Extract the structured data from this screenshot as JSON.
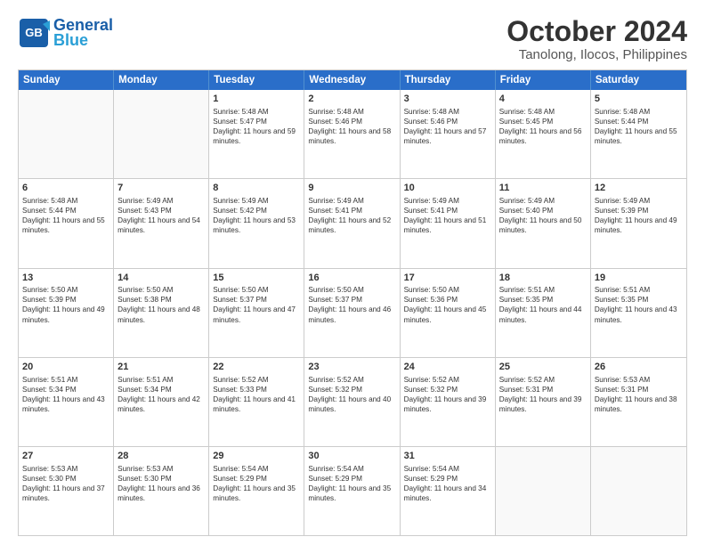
{
  "header": {
    "logo_line1": "General",
    "logo_line2": "Blue",
    "month": "October 2024",
    "location": "Tanolong, Ilocos, Philippines"
  },
  "days": [
    "Sunday",
    "Monday",
    "Tuesday",
    "Wednesday",
    "Thursday",
    "Friday",
    "Saturday"
  ],
  "weeks": [
    [
      {
        "day": "",
        "empty": true
      },
      {
        "day": "",
        "empty": true
      },
      {
        "day": "1",
        "sr": "5:48 AM",
        "ss": "5:47 PM",
        "dl": "11 hours and 59 minutes."
      },
      {
        "day": "2",
        "sr": "5:48 AM",
        "ss": "5:46 PM",
        "dl": "11 hours and 58 minutes."
      },
      {
        "day": "3",
        "sr": "5:48 AM",
        "ss": "5:46 PM",
        "dl": "11 hours and 57 minutes."
      },
      {
        "day": "4",
        "sr": "5:48 AM",
        "ss": "5:45 PM",
        "dl": "11 hours and 56 minutes."
      },
      {
        "day": "5",
        "sr": "5:48 AM",
        "ss": "5:44 PM",
        "dl": "11 hours and 55 minutes."
      }
    ],
    [
      {
        "day": "6",
        "sr": "5:48 AM",
        "ss": "5:44 PM",
        "dl": "11 hours and 55 minutes."
      },
      {
        "day": "7",
        "sr": "5:49 AM",
        "ss": "5:43 PM",
        "dl": "11 hours and 54 minutes."
      },
      {
        "day": "8",
        "sr": "5:49 AM",
        "ss": "5:42 PM",
        "dl": "11 hours and 53 minutes."
      },
      {
        "day": "9",
        "sr": "5:49 AM",
        "ss": "5:41 PM",
        "dl": "11 hours and 52 minutes."
      },
      {
        "day": "10",
        "sr": "5:49 AM",
        "ss": "5:41 PM",
        "dl": "11 hours and 51 minutes."
      },
      {
        "day": "11",
        "sr": "5:49 AM",
        "ss": "5:40 PM",
        "dl": "11 hours and 50 minutes."
      },
      {
        "day": "12",
        "sr": "5:49 AM",
        "ss": "5:39 PM",
        "dl": "11 hours and 49 minutes."
      }
    ],
    [
      {
        "day": "13",
        "sr": "5:50 AM",
        "ss": "5:39 PM",
        "dl": "11 hours and 49 minutes."
      },
      {
        "day": "14",
        "sr": "5:50 AM",
        "ss": "5:38 PM",
        "dl": "11 hours and 48 minutes."
      },
      {
        "day": "15",
        "sr": "5:50 AM",
        "ss": "5:37 PM",
        "dl": "11 hours and 47 minutes."
      },
      {
        "day": "16",
        "sr": "5:50 AM",
        "ss": "5:37 PM",
        "dl": "11 hours and 46 minutes."
      },
      {
        "day": "17",
        "sr": "5:50 AM",
        "ss": "5:36 PM",
        "dl": "11 hours and 45 minutes."
      },
      {
        "day": "18",
        "sr": "5:51 AM",
        "ss": "5:35 PM",
        "dl": "11 hours and 44 minutes."
      },
      {
        "day": "19",
        "sr": "5:51 AM",
        "ss": "5:35 PM",
        "dl": "11 hours and 43 minutes."
      }
    ],
    [
      {
        "day": "20",
        "sr": "5:51 AM",
        "ss": "5:34 PM",
        "dl": "11 hours and 43 minutes."
      },
      {
        "day": "21",
        "sr": "5:51 AM",
        "ss": "5:34 PM",
        "dl": "11 hours and 42 minutes."
      },
      {
        "day": "22",
        "sr": "5:52 AM",
        "ss": "5:33 PM",
        "dl": "11 hours and 41 minutes."
      },
      {
        "day": "23",
        "sr": "5:52 AM",
        "ss": "5:32 PM",
        "dl": "11 hours and 40 minutes."
      },
      {
        "day": "24",
        "sr": "5:52 AM",
        "ss": "5:32 PM",
        "dl": "11 hours and 39 minutes."
      },
      {
        "day": "25",
        "sr": "5:52 AM",
        "ss": "5:31 PM",
        "dl": "11 hours and 39 minutes."
      },
      {
        "day": "26",
        "sr": "5:53 AM",
        "ss": "5:31 PM",
        "dl": "11 hours and 38 minutes."
      }
    ],
    [
      {
        "day": "27",
        "sr": "5:53 AM",
        "ss": "5:30 PM",
        "dl": "11 hours and 37 minutes."
      },
      {
        "day": "28",
        "sr": "5:53 AM",
        "ss": "5:30 PM",
        "dl": "11 hours and 36 minutes."
      },
      {
        "day": "29",
        "sr": "5:54 AM",
        "ss": "5:29 PM",
        "dl": "11 hours and 35 minutes."
      },
      {
        "day": "30",
        "sr": "5:54 AM",
        "ss": "5:29 PM",
        "dl": "11 hours and 35 minutes."
      },
      {
        "day": "31",
        "sr": "5:54 AM",
        "ss": "5:29 PM",
        "dl": "11 hours and 34 minutes."
      },
      {
        "day": "",
        "empty": true
      },
      {
        "day": "",
        "empty": true
      }
    ]
  ]
}
